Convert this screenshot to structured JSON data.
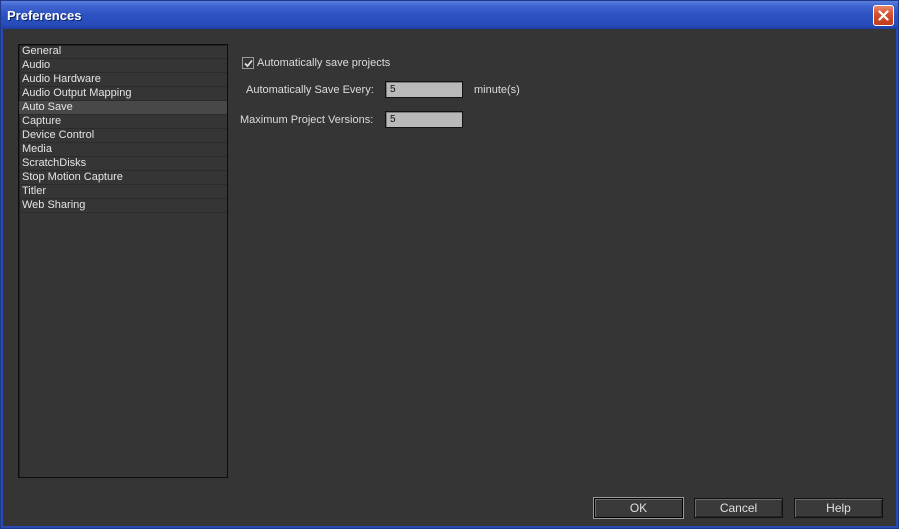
{
  "window": {
    "title": "Preferences"
  },
  "categories": [
    {
      "label": "General",
      "selected": false
    },
    {
      "label": "Audio",
      "selected": false
    },
    {
      "label": "Audio Hardware",
      "selected": false
    },
    {
      "label": "Audio Output Mapping",
      "selected": false
    },
    {
      "label": "Auto Save",
      "selected": true
    },
    {
      "label": "Capture",
      "selected": false
    },
    {
      "label": "Device Control",
      "selected": false
    },
    {
      "label": "Media",
      "selected": false
    },
    {
      "label": "ScratchDisks",
      "selected": false
    },
    {
      "label": "Stop Motion Capture",
      "selected": false
    },
    {
      "label": "Titler",
      "selected": false
    },
    {
      "label": "Web Sharing",
      "selected": false
    }
  ],
  "auto_save": {
    "enable_label": "Automatically save projects",
    "enabled": true,
    "interval_label": "Automatically Save Every:",
    "interval_value": "5",
    "interval_unit": "minute(s)",
    "versions_label": "Maximum Project Versions:",
    "versions_value": "5"
  },
  "buttons": {
    "ok": "OK",
    "cancel": "Cancel",
    "help": "Help"
  },
  "icons": {
    "close": "close-icon",
    "check": "checkmark-icon"
  },
  "colors": {
    "titlebar": "#2c52c2",
    "close_button": "#d2502e",
    "background": "#353535",
    "field": "#b9b9b9"
  }
}
